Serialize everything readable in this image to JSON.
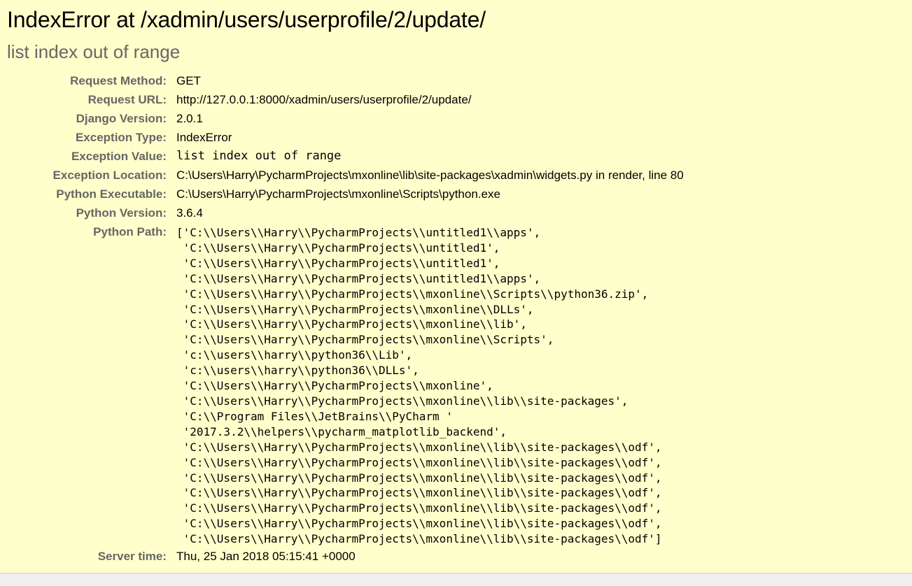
{
  "error": {
    "title": "IndexError at /xadmin/users/userprofile/2/update/",
    "message": "list index out of range"
  },
  "meta": {
    "request_method": {
      "label": "Request Method:",
      "value": "GET"
    },
    "request_url": {
      "label": "Request URL:",
      "value": "http://127.0.0.1:8000/xadmin/users/userprofile/2/update/"
    },
    "django_version": {
      "label": "Django Version:",
      "value": "2.0.1"
    },
    "exception_type": {
      "label": "Exception Type:",
      "value": "IndexError"
    },
    "exception_value": {
      "label": "Exception Value:",
      "value": "list index out of range"
    },
    "exception_location": {
      "label": "Exception Location:",
      "value": "C:\\Users\\Harry\\PycharmProjects\\mxonline\\lib\\site-packages\\xadmin\\widgets.py in render, line 80"
    },
    "python_executable": {
      "label": "Python Executable:",
      "value": "C:\\Users\\Harry\\PycharmProjects\\mxonline\\Scripts\\python.exe"
    },
    "python_version": {
      "label": "Python Version:",
      "value": "3.6.4"
    },
    "python_path": {
      "label": "Python Path:",
      "value": "['C:\\\\Users\\\\Harry\\\\PycharmProjects\\\\untitled1\\\\apps',\n 'C:\\\\Users\\\\Harry\\\\PycharmProjects\\\\untitled1',\n 'C:\\\\Users\\\\Harry\\\\PycharmProjects\\\\untitled1',\n 'C:\\\\Users\\\\Harry\\\\PycharmProjects\\\\untitled1\\\\apps',\n 'C:\\\\Users\\\\Harry\\\\PycharmProjects\\\\mxonline\\\\Scripts\\\\python36.zip',\n 'C:\\\\Users\\\\Harry\\\\PycharmProjects\\\\mxonline\\\\DLLs',\n 'C:\\\\Users\\\\Harry\\\\PycharmProjects\\\\mxonline\\\\lib',\n 'C:\\\\Users\\\\Harry\\\\PycharmProjects\\\\mxonline\\\\Scripts',\n 'c:\\\\users\\\\harry\\\\python36\\\\Lib',\n 'c:\\\\users\\\\harry\\\\python36\\\\DLLs',\n 'C:\\\\Users\\\\Harry\\\\PycharmProjects\\\\mxonline',\n 'C:\\\\Users\\\\Harry\\\\PycharmProjects\\\\mxonline\\\\lib\\\\site-packages',\n 'C:\\\\Program Files\\\\JetBrains\\\\PyCharm '\n '2017.3.2\\\\helpers\\\\pycharm_matplotlib_backend',\n 'C:\\\\Users\\\\Harry\\\\PycharmProjects\\\\mxonline\\\\lib\\\\site-packages\\\\odf',\n 'C:\\\\Users\\\\Harry\\\\PycharmProjects\\\\mxonline\\\\lib\\\\site-packages\\\\odf',\n 'C:\\\\Users\\\\Harry\\\\PycharmProjects\\\\mxonline\\\\lib\\\\site-packages\\\\odf',\n 'C:\\\\Users\\\\Harry\\\\PycharmProjects\\\\mxonline\\\\lib\\\\site-packages\\\\odf',\n 'C:\\\\Users\\\\Harry\\\\PycharmProjects\\\\mxonline\\\\lib\\\\site-packages\\\\odf',\n 'C:\\\\Users\\\\Harry\\\\PycharmProjects\\\\mxonline\\\\lib\\\\site-packages\\\\odf',\n 'C:\\\\Users\\\\Harry\\\\PycharmProjects\\\\mxonline\\\\lib\\\\site-packages\\\\odf']"
    },
    "server_time": {
      "label": "Server time:",
      "value": "Thu, 25 Jan 2018 05:15:41 +0000"
    }
  }
}
